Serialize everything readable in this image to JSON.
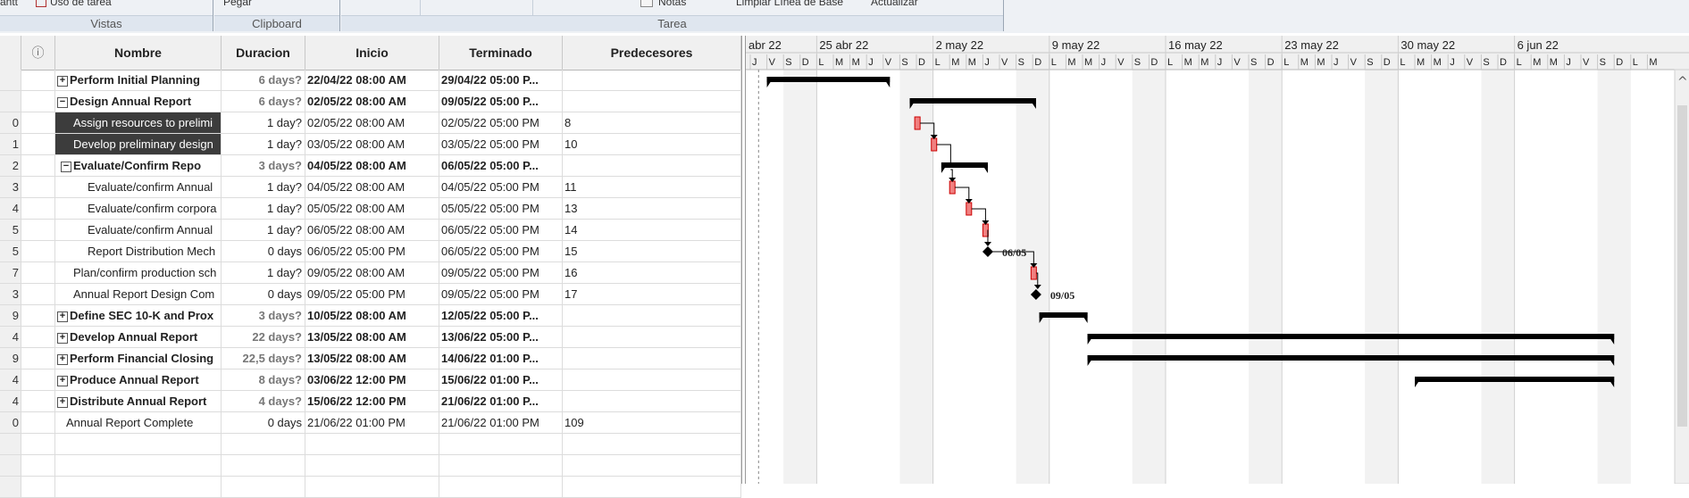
{
  "ribbon": {
    "vistas": {
      "label": "Vistas",
      "item1": "antt",
      "item2": "Uso de tarea"
    },
    "clipboard": {
      "label": "Clipboard",
      "item1": "Pegar"
    },
    "tarea": {
      "label": "Tarea",
      "notas": "Notas",
      "limpiar": "Limpiar Línea de Base",
      "actualizar": "Actualizar"
    }
  },
  "table": {
    "headers": {
      "id": "",
      "info": "ⓘ",
      "name": "Nombre",
      "duration": "Duracion",
      "start": "Inicio",
      "end": "Terminado",
      "pred": "Predecesores"
    },
    "rows": [
      {
        "id": "",
        "name": "Perform Initial Planning",
        "toggle": "+",
        "duration": "6 days?",
        "start": "22/04/22 08:00 AM",
        "end": "29/04/22 05:00 P...",
        "pred": "",
        "bold": true,
        "indent": 0,
        "selected": false
      },
      {
        "id": "",
        "name": "Design Annual Report",
        "toggle": "−",
        "duration": "6 days?",
        "start": "02/05/22 08:00 AM",
        "end": "09/05/22 05:00 P...",
        "pred": "",
        "bold": true,
        "indent": 0,
        "selected": false
      },
      {
        "id": "0",
        "name": "Assign resources to prelimi",
        "toggle": "",
        "duration": "1 day?",
        "start": "02/05/22 08:00 AM",
        "end": "02/05/22 05:00 PM",
        "pred": "8",
        "bold": false,
        "indent": 2,
        "selected": true
      },
      {
        "id": "1",
        "name": "Develop preliminary design",
        "toggle": "",
        "duration": "1 day?",
        "start": "03/05/22 08:00 AM",
        "end": "03/05/22 05:00 PM",
        "pred": "10",
        "bold": false,
        "indent": 2,
        "selected": true
      },
      {
        "id": "2",
        "name": "Evaluate/Confirm Repo",
        "toggle": "−",
        "duration": "3 days?",
        "start": "04/05/22 08:00 AM",
        "end": "06/05/22 05:00 P...",
        "pred": "",
        "bold": true,
        "indent": 1,
        "selected": false
      },
      {
        "id": "3",
        "name": "Evaluate/confirm Annual",
        "toggle": "",
        "duration": "1 day?",
        "start": "04/05/22 08:00 AM",
        "end": "04/05/22 05:00 PM",
        "pred": "11",
        "bold": false,
        "indent": 3,
        "selected": false
      },
      {
        "id": "4",
        "name": "Evaluate/confirm corpora",
        "toggle": "",
        "duration": "1 day?",
        "start": "05/05/22 08:00 AM",
        "end": "05/05/22 05:00 PM",
        "pred": "13",
        "bold": false,
        "indent": 3,
        "selected": false
      },
      {
        "id": "5",
        "name": "Evaluate/confirm Annual",
        "toggle": "",
        "duration": "1 day?",
        "start": "06/05/22 08:00 AM",
        "end": "06/05/22 05:00 PM",
        "pred": "14",
        "bold": false,
        "indent": 3,
        "selected": false
      },
      {
        "id": "5",
        "name": "Report Distribution Mech",
        "toggle": "",
        "duration": "0 days",
        "start": "06/05/22 05:00 PM",
        "end": "06/05/22 05:00 PM",
        "pred": "15",
        "bold": false,
        "indent": 3,
        "selected": false
      },
      {
        "id": "7",
        "name": "Plan/confirm production sch",
        "toggle": "",
        "duration": "1 day?",
        "start": "09/05/22 08:00 AM",
        "end": "09/05/22 05:00 PM",
        "pred": "16",
        "bold": false,
        "indent": 2,
        "selected": false
      },
      {
        "id": "3",
        "name": "Annual Report Design Com",
        "toggle": "",
        "duration": "0 days",
        "start": "09/05/22 05:00 PM",
        "end": "09/05/22 05:00 PM",
        "pred": "17",
        "bold": false,
        "indent": 2,
        "selected": false
      },
      {
        "id": "9",
        "name": "Define SEC 10-K and Prox",
        "toggle": "+",
        "duration": "3 days?",
        "start": "10/05/22 08:00 AM",
        "end": "12/05/22 05:00 P...",
        "pred": "",
        "bold": true,
        "indent": 0,
        "selected": false
      },
      {
        "id": "4",
        "name": "Develop Annual Report",
        "toggle": "+",
        "duration": "22 days?",
        "start": "13/05/22 08:00 AM",
        "end": "13/06/22 05:00 P...",
        "pred": "",
        "bold": true,
        "indent": 0,
        "selected": false
      },
      {
        "id": "9",
        "name": "Perform Financial Closing",
        "toggle": "+",
        "duration": "22,5 days?",
        "start": "13/05/22 08:00 AM",
        "end": "14/06/22 01:00 P...",
        "pred": "",
        "bold": true,
        "indent": 0,
        "selected": false
      },
      {
        "id": "4",
        "name": "Produce Annual Report",
        "toggle": "+",
        "duration": "8 days?",
        "start": "03/06/22 12:00 PM",
        "end": "15/06/22 01:00 P...",
        "pred": "",
        "bold": true,
        "indent": 0,
        "selected": false
      },
      {
        "id": "4",
        "name": "Distribute Annual Report",
        "toggle": "+",
        "duration": "4 days?",
        "start": "15/06/22 12:00 PM",
        "end": "21/06/22 01:00 P...",
        "pred": "",
        "bold": true,
        "indent": 0,
        "selected": false
      },
      {
        "id": "0",
        "name": "Annual Report Complete",
        "toggle": "",
        "duration": "0 days",
        "start": "21/06/22 01:00 PM",
        "end": "21/06/22 01:00 PM",
        "pred": "109",
        "bold": false,
        "indent": 1,
        "selected": false
      }
    ]
  },
  "gantt": {
    "weeks": [
      "abr 22",
      "25 abr 22",
      "2 may 22",
      "9 may 22",
      "16 may 22",
      "23 may 22",
      "30 may 22",
      "6 jun 22"
    ],
    "days": [
      "M",
      "M",
      "J",
      "V",
      "S",
      "D",
      "L"
    ],
    "milestone_labels": [
      "06/05",
      "09/05"
    ],
    "scroll_up_glyph": "^"
  }
}
